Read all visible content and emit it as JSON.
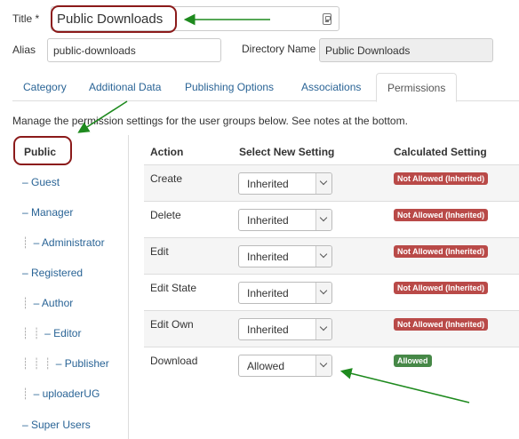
{
  "form": {
    "title_label": "Title *",
    "title_value": "Public Downloads",
    "alias_label": "Alias",
    "alias_value": "public-downloads",
    "directory_label": "Directory Name",
    "directory_value": "Public Downloads"
  },
  "tabs": [
    {
      "label": "Category"
    },
    {
      "label": "Additional Data"
    },
    {
      "label": "Publishing Options"
    },
    {
      "label": "Associations"
    },
    {
      "label": "Permissions"
    }
  ],
  "active_tab": "Permissions",
  "intro": "Manage the permission settings for the user groups below. See notes at the bottom.",
  "groups": [
    {
      "label": "Public",
      "depth": 0
    },
    {
      "label": "– Guest",
      "depth": 1
    },
    {
      "label": "– Manager",
      "depth": 1
    },
    {
      "label": "– Administrator",
      "depth": 2
    },
    {
      "label": "– Registered",
      "depth": 1
    },
    {
      "label": "– Author",
      "depth": 2
    },
    {
      "label": "– Editor",
      "depth": 3
    },
    {
      "label": "– Publisher",
      "depth": 4
    },
    {
      "label": "– uploaderUG",
      "depth": 2
    },
    {
      "label": "– Super Users",
      "depth": 1
    }
  ],
  "table": {
    "headers": {
      "action": "Action",
      "select": "Select New Setting",
      "calculated": "Calculated Setting"
    },
    "rows": [
      {
        "action": "Create",
        "setting": "Inherited",
        "calculated": "Not Allowed (Inherited)",
        "status": "denied"
      },
      {
        "action": "Delete",
        "setting": "Inherited",
        "calculated": "Not Allowed (Inherited)",
        "status": "denied"
      },
      {
        "action": "Edit",
        "setting": "Inherited",
        "calculated": "Not Allowed (Inherited)",
        "status": "denied"
      },
      {
        "action": "Edit State",
        "setting": "Inherited",
        "calculated": "Not Allowed (Inherited)",
        "status": "denied"
      },
      {
        "action": "Edit Own",
        "setting": "Inherited",
        "calculated": "Not Allowed (Inherited)",
        "status": "denied"
      },
      {
        "action": "Download",
        "setting": "Allowed",
        "calculated": "Allowed",
        "status": "allowed"
      }
    ]
  },
  "colors": {
    "link": "#2a6496",
    "denied_badge": "#b94a48",
    "allowed_badge": "#468847",
    "annotation_circle": "#8b1a1a",
    "annotation_arrow": "#1e8a1e"
  }
}
